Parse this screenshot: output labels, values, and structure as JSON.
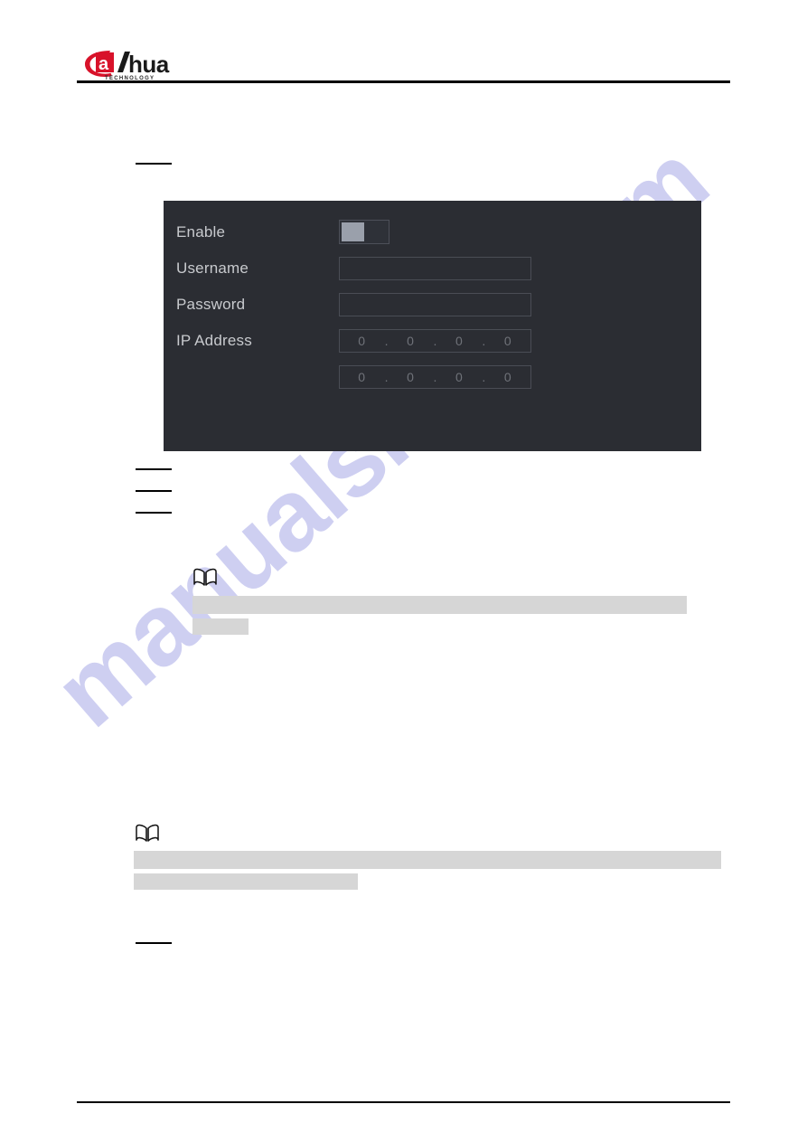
{
  "document": {
    "brand": "alhua",
    "brand_sub": "TECHNOLOGY",
    "watermark": "manualshive.com"
  },
  "dialog": {
    "name": "device-settings-dialog",
    "rows": [
      {
        "label": "Enable",
        "control": "toggle",
        "value": "off"
      },
      {
        "label": "Username",
        "control": "text",
        "value": ""
      },
      {
        "label": "Password",
        "control": "text",
        "value": ""
      },
      {
        "label": "IP Address",
        "control": "ip",
        "value": "0.0.0.0"
      },
      {
        "label": "",
        "control": "ip",
        "value": "0.0.0.0"
      }
    ],
    "ip_octets": [
      "0",
      "0",
      "0",
      "0"
    ],
    "ip_separator": ".",
    "colors": {
      "panel_bg": "#2b2d33",
      "label_text": "#c8cace",
      "field_border": "#4a4d55",
      "placeholder_text": "#6f7279",
      "toggle_knob": "#9aa0ab"
    }
  },
  "notes": [
    {
      "icon": "book-icon",
      "redacted_lines": 2
    },
    {
      "icon": "book-icon",
      "redacted_lines": 2
    }
  ],
  "redacted": {
    "step_marks": 4,
    "bar_color": "#d6d6d6",
    "rule_color": "#000000"
  }
}
